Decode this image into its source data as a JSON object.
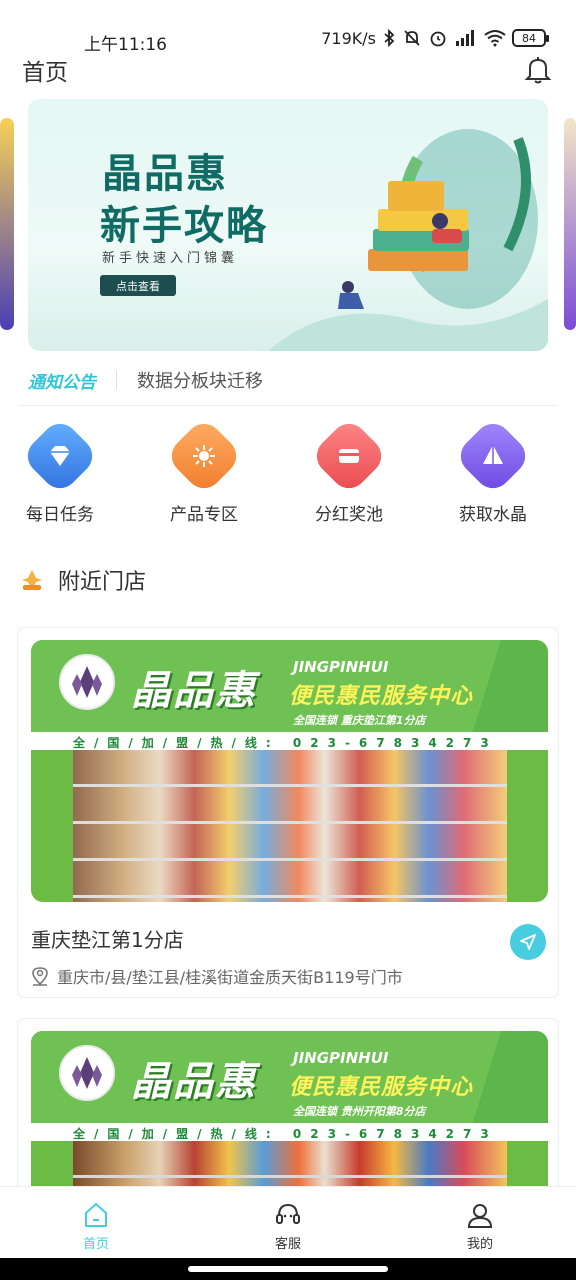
{
  "status_bar": {
    "time": "上午11:16",
    "speed": "719K/s",
    "battery": "84"
  },
  "header": {
    "title": "首页"
  },
  "banner": {
    "title_line1": "晶品惠",
    "title_line2": "新手攻略",
    "subtitle": "新手快速入门锦囊",
    "button": "点击查看"
  },
  "notice": {
    "tag": "通知公告",
    "text": "数据分板块迁移"
  },
  "quick_menu": [
    {
      "label": "每日任务",
      "icon": "diamond-icon",
      "color": "#3b86ee"
    },
    {
      "label": "产品专区",
      "icon": "sparkle-icon",
      "color": "#f5903a"
    },
    {
      "label": "分红奖池",
      "icon": "card-icon",
      "color": "#f2575a"
    },
    {
      "label": "获取水晶",
      "icon": "crystal-icon",
      "color": "#7b5ce8"
    }
  ],
  "section": {
    "title": "附近门店"
  },
  "stores": [
    {
      "brand": "晶品惠",
      "brand_en": "JINGPINHUI",
      "slogan": "便民惠民服务中心",
      "tag": "全国连锁  重庆垫江第1分店",
      "hotline": "全/国/加/盟/热/线: 023-67834273",
      "name": "重庆垫江第1分店",
      "address": "重庆市/县/垫江县/桂溪街道金质天街B119号门市"
    },
    {
      "brand": "晶品惠",
      "brand_en": "JINGPINHUI",
      "slogan": "便民惠民服务中心",
      "tag": "全国连锁  贵州开阳第8分店",
      "hotline": "全/国/加/盟/热/线: 023-67834273"
    }
  ],
  "bottom_nav": [
    {
      "label": "首页",
      "icon": "home-icon",
      "active": true
    },
    {
      "label": "客服",
      "icon": "customer-service-icon",
      "active": false
    },
    {
      "label": "我的",
      "icon": "profile-icon",
      "active": false
    }
  ],
  "colors": {
    "accent": "#3fd0de",
    "brand_green": "#5eb54b"
  }
}
